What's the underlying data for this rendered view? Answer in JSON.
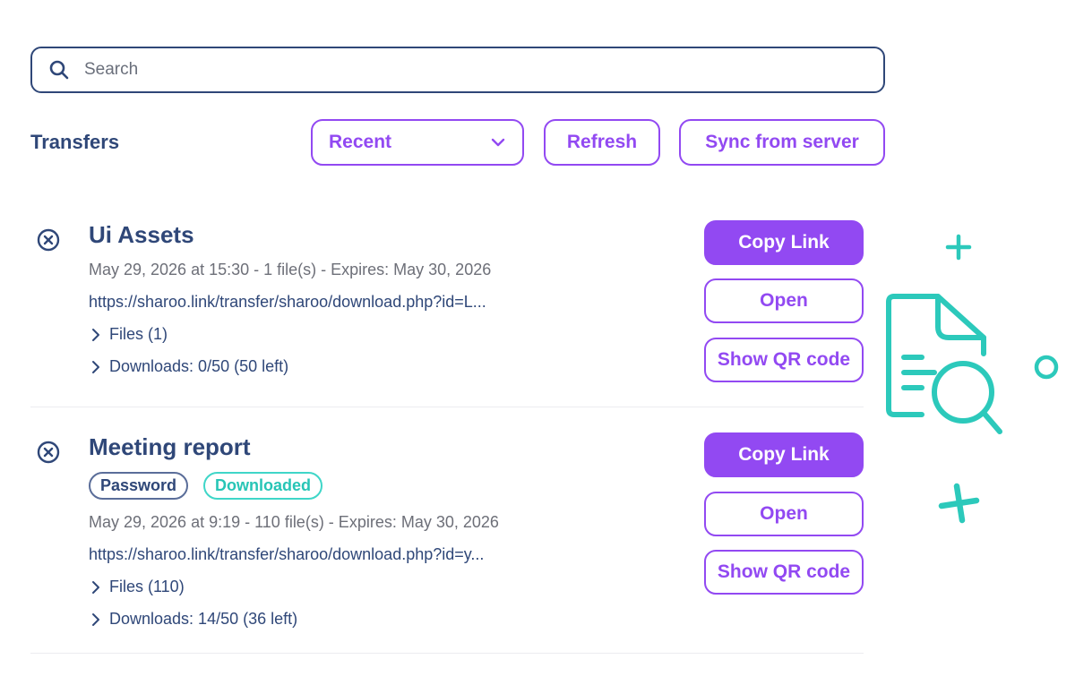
{
  "search": {
    "placeholder": "Search"
  },
  "header": {
    "title": "Transfers",
    "filter_selected": "Recent",
    "refresh_label": "Refresh",
    "sync_label": "Sync from server"
  },
  "transfers": [
    {
      "title": "Ui Assets",
      "badges": [],
      "meta": "May 29, 2026 at 15:30 - 1 file(s) - Expires: May 30, 2026",
      "url": "https://sharoo.link/transfer/sharoo/download.php?id=L...",
      "files_label": "Files (1)",
      "downloads_label": "Downloads: 0/50 (50 left)",
      "copy_label": "Copy Link",
      "open_label": "Open",
      "qr_label": "Show QR code"
    },
    {
      "title": "Meeting report",
      "badges": [
        "Password",
        "Downloaded"
      ],
      "meta": "May 29, 2026 at 9:19 - 110 file(s) - Expires: May 30, 2026",
      "url": "https://sharoo.link/transfer/sharoo/download.php?id=y...",
      "files_label": "Files (110)",
      "downloads_label": "Downloads: 14/50 (36 left)",
      "copy_label": "Copy Link",
      "open_label": "Open",
      "qr_label": "Show QR code"
    }
  ],
  "colors": {
    "primary": "#9249f2",
    "navy": "#2f4778",
    "teal": "#27c5b6",
    "muted": "#6d6f78"
  },
  "icons": [
    "search-icon",
    "chevron-down-icon",
    "remove-circle-icon",
    "chevron-right-icon",
    "document-search-icon"
  ]
}
